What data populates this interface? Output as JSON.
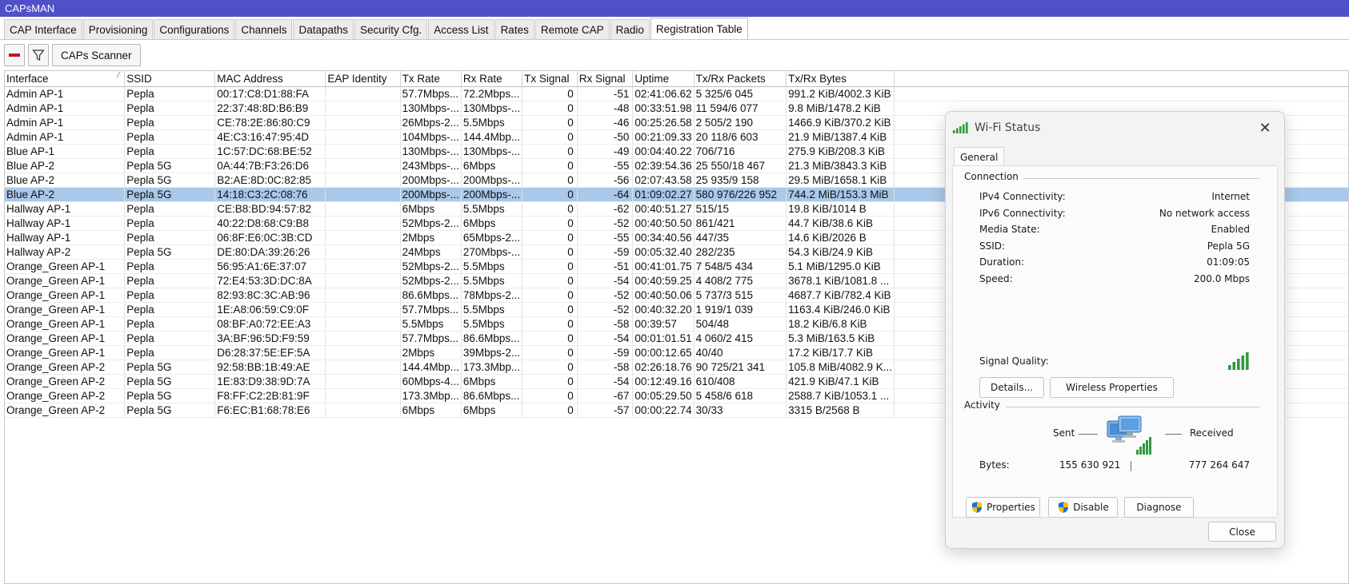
{
  "app": {
    "title": "CAPsMAN"
  },
  "tabs": [
    {
      "label": "CAP Interface"
    },
    {
      "label": "Provisioning"
    },
    {
      "label": "Configurations"
    },
    {
      "label": "Channels"
    },
    {
      "label": "Datapaths"
    },
    {
      "label": "Security Cfg."
    },
    {
      "label": "Access List"
    },
    {
      "label": "Rates"
    },
    {
      "label": "Remote CAP"
    },
    {
      "label": "Radio"
    },
    {
      "label": "Registration Table",
      "active": true
    }
  ],
  "toolbar": {
    "remove_icon": "minus-icon",
    "filter_icon": "filter-icon",
    "scanner_label": "CAPs Scanner"
  },
  "table": {
    "columns": [
      {
        "key": "interface",
        "label": "Interface"
      },
      {
        "key": "ssid",
        "label": "SSID"
      },
      {
        "key": "mac",
        "label": "MAC Address"
      },
      {
        "key": "eap",
        "label": "EAP Identity"
      },
      {
        "key": "tx_rate",
        "label": "Tx Rate"
      },
      {
        "key": "rx_rate",
        "label": "Rx Rate"
      },
      {
        "key": "tx_signal",
        "label": "Tx Signal"
      },
      {
        "key": "rx_signal",
        "label": "Rx Signal"
      },
      {
        "key": "uptime",
        "label": "Uptime"
      },
      {
        "key": "packets",
        "label": "Tx/Rx Packets"
      },
      {
        "key": "bytes",
        "label": "Tx/Rx Bytes"
      }
    ],
    "rows": [
      {
        "interface": "Admin AP-1",
        "ssid": "Pepla",
        "mac": "00:17:C8:D1:88:FA",
        "eap": "",
        "tx_rate": "57.7Mbps...",
        "rx_rate": "72.2Mbps...",
        "tx_signal": "0",
        "rx_signal": "-51",
        "uptime": "02:41:06.62",
        "packets": "5 325/6 045",
        "bytes": "991.2 KiB/4002.3 KiB"
      },
      {
        "interface": "Admin AP-1",
        "ssid": "Pepla",
        "mac": "22:37:48:8D:B6:B9",
        "eap": "",
        "tx_rate": "130Mbps-...",
        "rx_rate": "130Mbps-...",
        "tx_signal": "0",
        "rx_signal": "-48",
        "uptime": "00:33:51.98",
        "packets": "11 594/6 077",
        "bytes": "9.8 MiB/1478.2 KiB"
      },
      {
        "interface": "Admin AP-1",
        "ssid": "Pepla",
        "mac": "CE:78:2E:86:80:C9",
        "eap": "",
        "tx_rate": "26Mbps-2...",
        "rx_rate": "5.5Mbps",
        "tx_signal": "0",
        "rx_signal": "-46",
        "uptime": "00:25:26.58",
        "packets": "2 505/2 190",
        "bytes": "1466.9 KiB/370.2 KiB"
      },
      {
        "interface": "Admin AP-1",
        "ssid": "Pepla",
        "mac": "4E:C3:16:47:95:4D",
        "eap": "",
        "tx_rate": "104Mbps-...",
        "rx_rate": "144.4Mbp...",
        "tx_signal": "0",
        "rx_signal": "-50",
        "uptime": "00:21:09.33",
        "packets": "20 118/6 603",
        "bytes": "21.9 MiB/1387.4 KiB"
      },
      {
        "interface": "Blue AP-1",
        "ssid": "Pepla",
        "mac": "1C:57:DC:68:BE:52",
        "eap": "",
        "tx_rate": "130Mbps-...",
        "rx_rate": "130Mbps-...",
        "tx_signal": "0",
        "rx_signal": "-49",
        "uptime": "00:04:40.22",
        "packets": "706/716",
        "bytes": "275.9 KiB/208.3 KiB"
      },
      {
        "interface": "Blue AP-2",
        "ssid": "Pepla 5G",
        "mac": "0A:44:7B:F3:26:D6",
        "eap": "",
        "tx_rate": "243Mbps-...",
        "rx_rate": "6Mbps",
        "tx_signal": "0",
        "rx_signal": "-55",
        "uptime": "02:39:54.36",
        "packets": "25 550/18 467",
        "bytes": "21.3 MiB/3843.3 KiB"
      },
      {
        "interface": "Blue AP-2",
        "ssid": "Pepla 5G",
        "mac": "B2:AE:8D:0C:82:85",
        "eap": "",
        "tx_rate": "200Mbps-...",
        "rx_rate": "200Mbps-...",
        "tx_signal": "0",
        "rx_signal": "-56",
        "uptime": "02:07:43.58",
        "packets": "25 935/9 158",
        "bytes": "29.5 MiB/1658.1 KiB"
      },
      {
        "interface": "Blue AP-2",
        "ssid": "Pepla 5G",
        "mac": "14:18:C3:2C:08:76",
        "eap": "",
        "tx_rate": "200Mbps-...",
        "rx_rate": "200Mbps-...",
        "tx_signal": "0",
        "rx_signal": "-64",
        "uptime": "01:09:02.27",
        "packets": "580 976/226 952",
        "bytes": "744.2 MiB/153.3 MiB",
        "selected": true
      },
      {
        "interface": "Hallway AP-1",
        "ssid": "Pepla",
        "mac": "CE:B8:BD:94:57:82",
        "eap": "",
        "tx_rate": "6Mbps",
        "rx_rate": "5.5Mbps",
        "tx_signal": "0",
        "rx_signal": "-62",
        "uptime": "00:40:51.27",
        "packets": "515/15",
        "bytes": "19.8 KiB/1014 B"
      },
      {
        "interface": "Hallway AP-1",
        "ssid": "Pepla",
        "mac": "40:22:D8:68:C9:B8",
        "eap": "",
        "tx_rate": "52Mbps-2...",
        "rx_rate": "6Mbps",
        "tx_signal": "0",
        "rx_signal": "-52",
        "uptime": "00:40:50.50",
        "packets": "861/421",
        "bytes": "44.7 KiB/38.6 KiB"
      },
      {
        "interface": "Hallway AP-1",
        "ssid": "Pepla",
        "mac": "06:8F:E6:0C:3B:CD",
        "eap": "",
        "tx_rate": "2Mbps",
        "rx_rate": "65Mbps-2...",
        "tx_signal": "0",
        "rx_signal": "-55",
        "uptime": "00:34:40.56",
        "packets": "447/35",
        "bytes": "14.6 KiB/2026 B"
      },
      {
        "interface": "Hallway AP-2",
        "ssid": "Pepla 5G",
        "mac": "DE:80:DA:39:26:26",
        "eap": "",
        "tx_rate": "24Mbps",
        "rx_rate": "270Mbps-...",
        "tx_signal": "0",
        "rx_signal": "-59",
        "uptime": "00:05:32.40",
        "packets": "282/235",
        "bytes": "54.3 KiB/24.9 KiB"
      },
      {
        "interface": "Orange_Green AP-1",
        "ssid": "Pepla",
        "mac": "56:95:A1:6E:37:07",
        "eap": "",
        "tx_rate": "52Mbps-2...",
        "rx_rate": "5.5Mbps",
        "tx_signal": "0",
        "rx_signal": "-51",
        "uptime": "00:41:01.75",
        "packets": "7 548/5 434",
        "bytes": "5.1 MiB/1295.0 KiB"
      },
      {
        "interface": "Orange_Green AP-1",
        "ssid": "Pepla",
        "mac": "72:E4:53:3D:DC:8A",
        "eap": "",
        "tx_rate": "52Mbps-2...",
        "rx_rate": "5.5Mbps",
        "tx_signal": "0",
        "rx_signal": "-54",
        "uptime": "00:40:59.25",
        "packets": "4 408/2 775",
        "bytes": "3678.1 KiB/1081.8 ..."
      },
      {
        "interface": "Orange_Green AP-1",
        "ssid": "Pepla",
        "mac": "82:93:8C:3C:AB:96",
        "eap": "",
        "tx_rate": "86.6Mbps...",
        "rx_rate": "78Mbps-2...",
        "tx_signal": "0",
        "rx_signal": "-52",
        "uptime": "00:40:50.06",
        "packets": "5 737/3 515",
        "bytes": "4687.7 KiB/782.4 KiB"
      },
      {
        "interface": "Orange_Green AP-1",
        "ssid": "Pepla",
        "mac": "1E:A8:06:59:C9:0F",
        "eap": "",
        "tx_rate": "57.7Mbps...",
        "rx_rate": "5.5Mbps",
        "tx_signal": "0",
        "rx_signal": "-52",
        "uptime": "00:40:32.20",
        "packets": "1 919/1 039",
        "bytes": "1163.4 KiB/246.0 KiB"
      },
      {
        "interface": "Orange_Green AP-1",
        "ssid": "Pepla",
        "mac": "08:BF:A0:72:EE:A3",
        "eap": "",
        "tx_rate": "5.5Mbps",
        "rx_rate": "5.5Mbps",
        "tx_signal": "0",
        "rx_signal": "-58",
        "uptime": "00:39:57",
        "packets": "504/48",
        "bytes": "18.2 KiB/6.8 KiB"
      },
      {
        "interface": "Orange_Green AP-1",
        "ssid": "Pepla",
        "mac": "3A:BF:96:5D:F9:59",
        "eap": "",
        "tx_rate": "57.7Mbps...",
        "rx_rate": "86.6Mbps...",
        "tx_signal": "0",
        "rx_signal": "-54",
        "uptime": "00:01:01.51",
        "packets": "4 060/2 415",
        "bytes": "5.3 MiB/163.5 KiB"
      },
      {
        "interface": "Orange_Green AP-1",
        "ssid": "Pepla",
        "mac": "D6:28:37:5E:EF:5A",
        "eap": "",
        "tx_rate": "2Mbps",
        "rx_rate": "39Mbps-2...",
        "tx_signal": "0",
        "rx_signal": "-59",
        "uptime": "00:00:12.65",
        "packets": "40/40",
        "bytes": "17.2 KiB/17.7 KiB"
      },
      {
        "interface": "Orange_Green AP-2",
        "ssid": "Pepla 5G",
        "mac": "92:58:BB:1B:49:AE",
        "eap": "",
        "tx_rate": "144.4Mbp...",
        "rx_rate": "173.3Mbp...",
        "tx_signal": "0",
        "rx_signal": "-58",
        "uptime": "02:26:18.76",
        "packets": "90 725/21 341",
        "bytes": "105.8 MiB/4082.9 K..."
      },
      {
        "interface": "Orange_Green AP-2",
        "ssid": "Pepla 5G",
        "mac": "1E:83:D9:38:9D:7A",
        "eap": "",
        "tx_rate": "60Mbps-4...",
        "rx_rate": "6Mbps",
        "tx_signal": "0",
        "rx_signal": "-54",
        "uptime": "00:12:49.16",
        "packets": "610/408",
        "bytes": "421.9 KiB/47.1 KiB"
      },
      {
        "interface": "Orange_Green AP-2",
        "ssid": "Pepla 5G",
        "mac": "F8:FF:C2:2B:81:9F",
        "eap": "",
        "tx_rate": "173.3Mbp...",
        "rx_rate": "86.6Mbps...",
        "tx_signal": "0",
        "rx_signal": "-67",
        "uptime": "00:05:29.50",
        "packets": "5 458/6 618",
        "bytes": "2588.7 KiB/1053.1 ..."
      },
      {
        "interface": "Orange_Green AP-2",
        "ssid": "Pepla 5G",
        "mac": "F6:EC:B1:68:78:E6",
        "eap": "",
        "tx_rate": "6Mbps",
        "rx_rate": "6Mbps",
        "tx_signal": "0",
        "rx_signal": "-57",
        "uptime": "00:00:22.74",
        "packets": "30/33",
        "bytes": "3315 B/2568 B"
      }
    ]
  },
  "wifi_dialog": {
    "title": "Wi-Fi Status",
    "tab": "General",
    "connection_label": "Connection",
    "fields": [
      {
        "label": "IPv4 Connectivity:",
        "value": "Internet"
      },
      {
        "label": "IPv6 Connectivity:",
        "value": "No network access"
      },
      {
        "label": "Media State:",
        "value": "Enabled"
      },
      {
        "label": "SSID:",
        "value": "Pepla 5G"
      },
      {
        "label": "Duration:",
        "value": "01:09:05"
      },
      {
        "label": "Speed:",
        "value": "200.0 Mbps"
      }
    ],
    "signal_quality_label": "Signal Quality:",
    "signal_bars": 5,
    "details_button": "Details...",
    "wireless_properties_button": "Wireless Properties",
    "activity_label": "Activity",
    "sent_label": "Sent",
    "received_label": "Received",
    "bytes_label": "Bytes:",
    "bytes_sent": "155 630 921",
    "bytes_received": "777 264 647",
    "properties_button": "Properties",
    "disable_button": "Disable",
    "diagnose_button": "Diagnose",
    "close_button": "Close",
    "colors": {
      "signal_green": "#2e9a3e",
      "shield_blue": "#1f6fd1",
      "shield_yellow": "#f2c400"
    }
  },
  "colors": {
    "titlebar": "#5050c8",
    "selected_row": "#a9c8ea",
    "remove_red": "#c8102e"
  }
}
